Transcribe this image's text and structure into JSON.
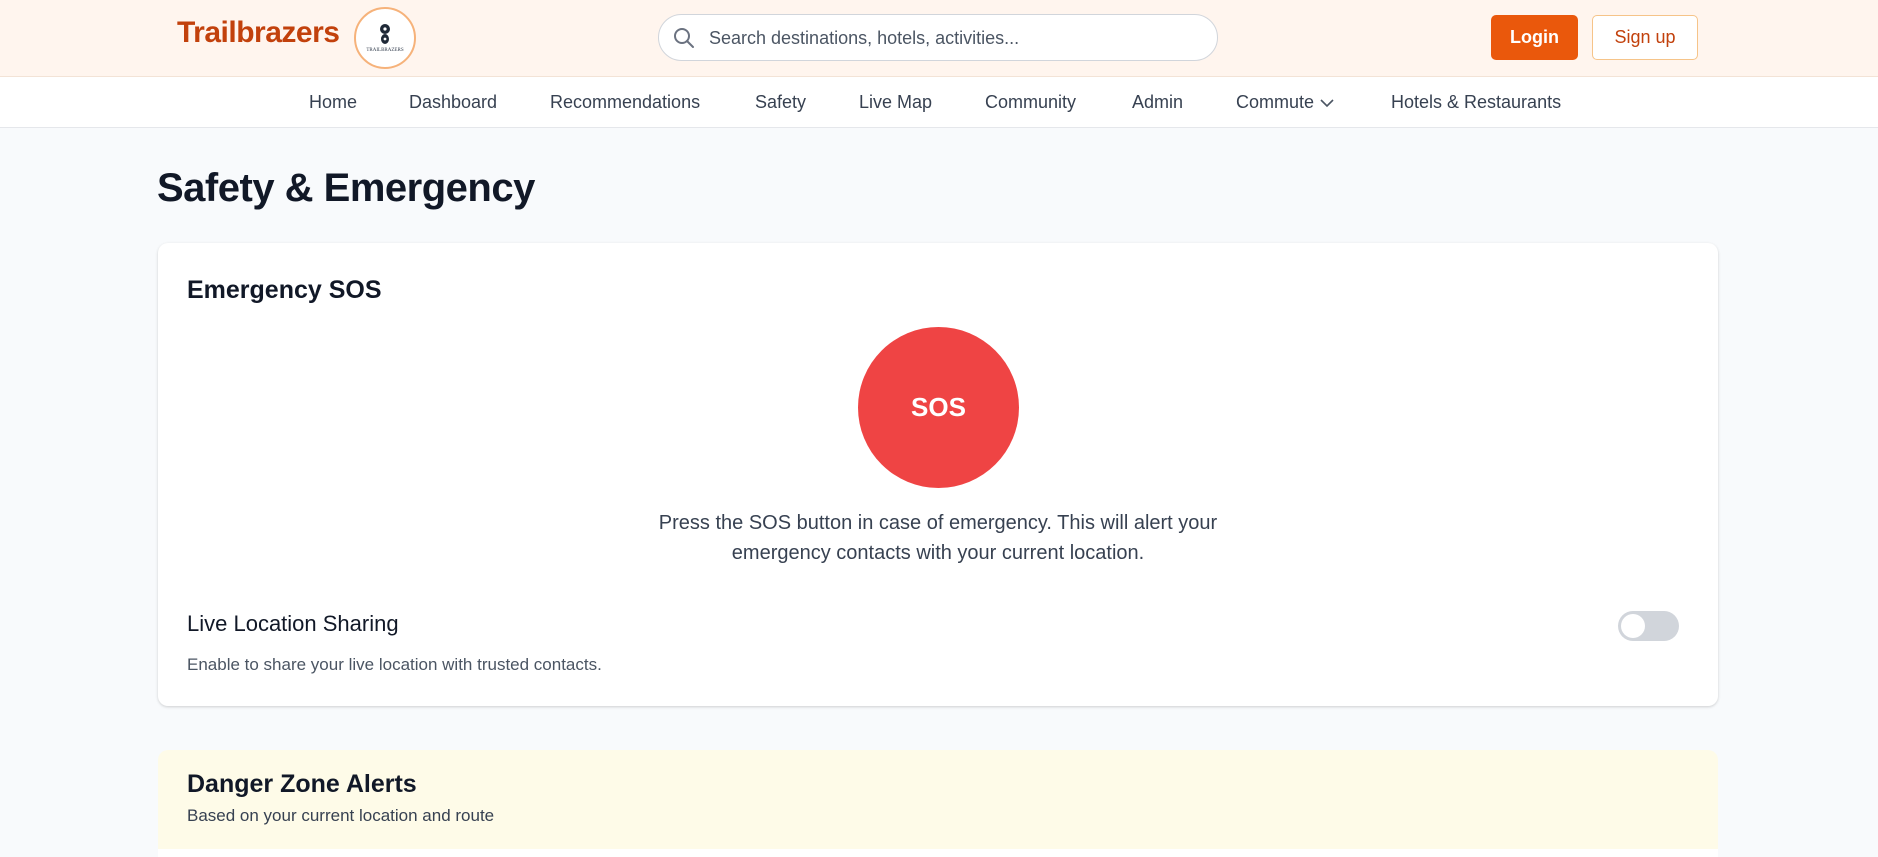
{
  "header": {
    "brand": "Trailbrazers",
    "logo_text": "TRAILBRAZERS",
    "search_placeholder": "Search destinations, hotels, activities...",
    "login_label": "Login",
    "signup_label": "Sign up"
  },
  "nav": {
    "items": [
      "Home",
      "Dashboard",
      "Recommendations",
      "Safety",
      "Live Map",
      "Community",
      "Admin",
      "Commute",
      "Hotels & Restaurants"
    ]
  },
  "page": {
    "title": "Safety & Emergency"
  },
  "sos_card": {
    "title": "Emergency SOS",
    "button_label": "SOS",
    "description": "Press the SOS button in case of emergency. This will alert your emergency contacts with your current location.",
    "live_title": "Live Location Sharing",
    "live_description": "Enable to share your live location with trusted contacts.",
    "live_enabled": false
  },
  "danger_card": {
    "title": "Danger Zone Alerts",
    "subtitle": "Based on your current location and route"
  },
  "colors": {
    "brand": "#c2410c",
    "accent": "#ea580c",
    "sos": "#ef4444",
    "header_bg": "#fff5ee",
    "danger_bg": "#fefbe8"
  }
}
